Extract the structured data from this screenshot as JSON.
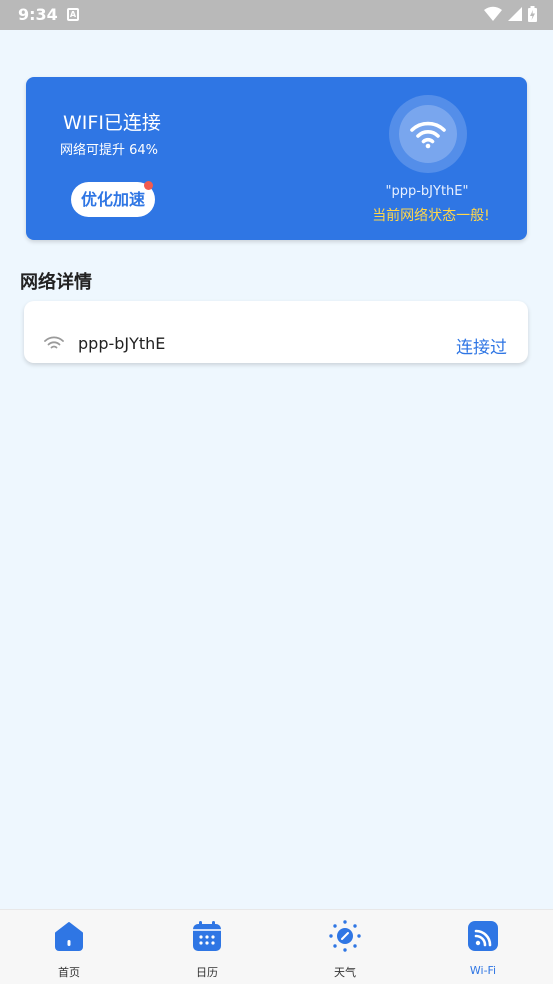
{
  "statusbar": {
    "time": "9:34",
    "notification_icon_letter": "A"
  },
  "colors": {
    "accent": "#2f76e4",
    "card_bg": "#2f76e4",
    "warning_text": "#ffd64a",
    "badge_dot": "#f35b4e",
    "page_bg": "#eef7fe"
  },
  "wifi_card": {
    "title": "WIFI已连接",
    "subtitle": "网络可提升 64%",
    "boost_button": "优化加速",
    "ssid": "\"ppp-bJYthE\"",
    "state_message": "当前网络状态一般!",
    "icon": "wifi-icon"
  },
  "network_section": {
    "title": "网络详情",
    "items": [
      {
        "name": "ppp-bJYthE",
        "status": "连接过",
        "icon": "wifi-signal-icon"
      }
    ]
  },
  "tabbar": {
    "tabs": [
      {
        "label": "首页",
        "icon": "home-icon",
        "active": false
      },
      {
        "label": "日历",
        "icon": "calendar-icon",
        "active": false
      },
      {
        "label": "天气",
        "icon": "weather-icon",
        "active": false
      },
      {
        "label": "Wi-Fi",
        "icon": "wifi-tab-icon",
        "active": true
      }
    ]
  }
}
